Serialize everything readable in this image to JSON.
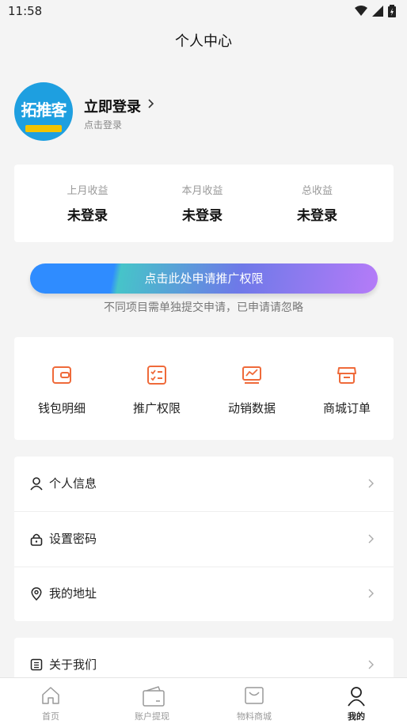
{
  "status_bar": {
    "time": "11:58"
  },
  "header": {
    "title": "个人中心"
  },
  "profile": {
    "avatar_text": "拓推客",
    "avatar_subtext": "TUOTUIKE",
    "login_title": "立即登录",
    "login_subtitle": "点击登录"
  },
  "income": [
    {
      "label": "上月收益",
      "value": "未登录"
    },
    {
      "label": "本月收益",
      "value": "未登录"
    },
    {
      "label": "总收益",
      "value": "未登录"
    }
  ],
  "apply": {
    "button_label": "点击此处申请推广权限",
    "hint": "不同项目需单独提交申请，已申请请忽略"
  },
  "shortcuts": [
    {
      "label": "钱包明细",
      "icon": "wallet-icon"
    },
    {
      "label": "推广权限",
      "icon": "checklist-icon"
    },
    {
      "label": "动销数据",
      "icon": "chart-icon"
    },
    {
      "label": "商城订单",
      "icon": "store-icon"
    }
  ],
  "menu": [
    {
      "label": "个人信息",
      "icon": "person-icon"
    },
    {
      "label": "设置密码",
      "icon": "lock-icon"
    },
    {
      "label": "我的地址",
      "icon": "location-icon"
    },
    {
      "label": "关于我们",
      "icon": "document-icon"
    }
  ],
  "tabbar": [
    {
      "label": "首页",
      "icon": "home-icon"
    },
    {
      "label": "账户提现",
      "icon": "wallet-tab-icon"
    },
    {
      "label": "物料商城",
      "icon": "bag-icon"
    },
    {
      "label": "我的",
      "icon": "user-tab-icon"
    }
  ],
  "colors": {
    "accent_orange": "#ef6a3a",
    "button_blue": "#2f8cff",
    "button_purple": "#b57bf8",
    "avatar_bg": "#1e9fe0"
  }
}
